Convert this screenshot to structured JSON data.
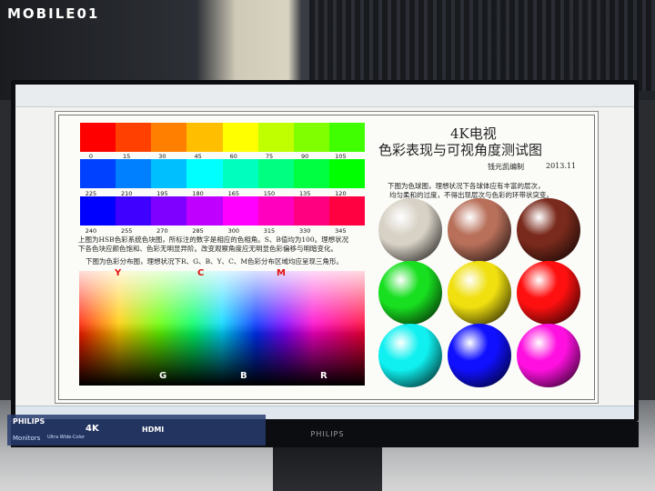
{
  "watermark": "MOBILE01",
  "bezel_brand": "PHILIPS",
  "osd": {
    "brand": "PHILIPS",
    "monitors": "Monitors",
    "res": "4K",
    "ultra": "Ultra Wide-Color",
    "hdmi": "HDMI"
  },
  "sheet": {
    "title1": "4K电视",
    "title2": "色彩表现与可视角度测试图",
    "author": "钱元凯编制",
    "year": "2013.11",
    "hue_row1": [
      "0",
      "15",
      "30",
      "45",
      "60",
      "75",
      "90",
      "105"
    ],
    "hue_row2": [
      "225",
      "210",
      "195",
      "180",
      "165",
      "150",
      "135",
      "120"
    ],
    "hue_row3": [
      "240",
      "255",
      "270",
      "285",
      "300",
      "315",
      "330",
      "345"
    ],
    "desc1": "上图为HSB色彩系统色块图，所标注的数字是相应的色相角。S、B值均为100。理想状况",
    "desc2": "下各色块应颜色饱和、色彩无明显异阶。改变观察角度应无明显色彩偏移与明暗变化。",
    "desc3": "下图为色彩分布图，理想状况下R、G、B、Y、C、M色彩分布区域均应呈现三角形。",
    "right1": "下图为色球图，理想状况下各球体应有丰富的层次，",
    "right2": "均匀柔和的过度，不得出现层次与色彩的环带状突变。",
    "labels_top": [
      "Y",
      "C",
      "M"
    ],
    "labels_bottom": [
      "G",
      "B",
      "R"
    ]
  },
  "colors": {
    "row1": [
      "#ff0000",
      "#ff4000",
      "#ff8000",
      "#ffbf00",
      "#ffff00",
      "#bfff00",
      "#80ff00",
      "#40ff00"
    ],
    "row2": [
      "#0040ff",
      "#0080ff",
      "#00bfff",
      "#00ffff",
      "#00ffbf",
      "#00ff80",
      "#00ff40",
      "#00ff00"
    ],
    "row3": [
      "#0000ff",
      "#4000ff",
      "#8000ff",
      "#bf00ff",
      "#ff00ff",
      "#ff00bf",
      "#ff0080",
      "#ff0040"
    ],
    "spheres": [
      "#d8d2c6",
      "#b8705a",
      "#7a2a1c",
      "#18e020",
      "#f0e010",
      "#ff1010",
      "#10f0f0",
      "#1010ff",
      "#ff10e0"
    ]
  }
}
